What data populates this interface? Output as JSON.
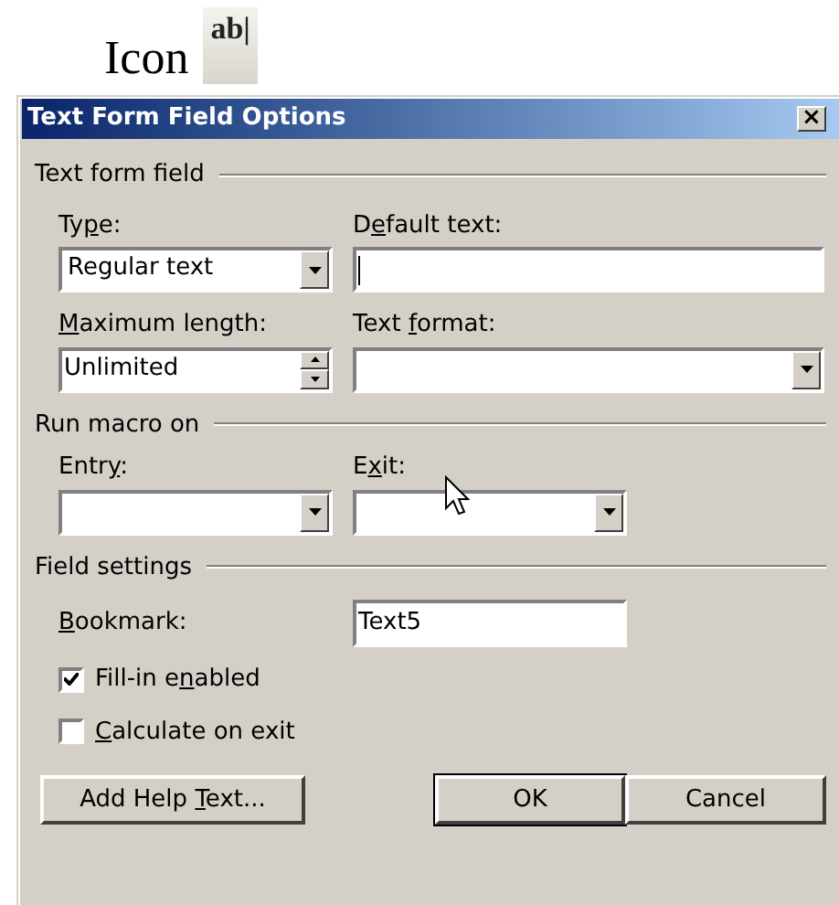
{
  "heading": {
    "text": "Icon",
    "icon_text": "ab|"
  },
  "window": {
    "title": "Text Form Field Options",
    "close": "×"
  },
  "sections": [
    {
      "title": "Text form field",
      "rows": [
        [
          {
            "kind": "combo",
            "label": {
              "before": "Ty",
              "key": "p",
              "after": "e:"
            },
            "value": "Regular text"
          },
          {
            "kind": "text",
            "label": {
              "before": "D",
              "key": "e",
              "after": "fault text:"
            },
            "focused": true
          }
        ],
        [
          {
            "kind": "spin",
            "label": {
              "key": "M",
              "after": "aximum length:"
            },
            "value": "Unlimited"
          },
          {
            "kind": "combo",
            "label": {
              "before": "Text ",
              "key": "f",
              "after": "ormat:"
            }
          }
        ]
      ]
    },
    {
      "title": "Run macro on",
      "rows": [
        [
          {
            "kind": "combo",
            "label": {
              "before": "Entr",
              "key": "y",
              "after": ":"
            }
          },
          {
            "kind": "combo",
            "label": {
              "before": "E",
              "key": "x",
              "after": "it:"
            }
          }
        ]
      ]
    },
    {
      "title": "Field settings",
      "bookmark": {
        "label": {
          "key": "B",
          "after": "ookmark:"
        },
        "value": "Text5"
      },
      "checks": [
        {
          "label": {
            "before": "Fill-in e",
            "key": "n",
            "after": "abled"
          },
          "checked": true
        },
        {
          "label": {
            "key": "C",
            "after": "alculate on exit"
          },
          "checked": false
        }
      ]
    }
  ],
  "buttons": [
    {
      "label": {
        "before": "Add Help ",
        "key": "T",
        "after": "ext..."
      },
      "default": false
    },
    {
      "label": {
        "before": "OK"
      },
      "default": true
    },
    {
      "label": {
        "before": "Cancel"
      },
      "default": false
    }
  ]
}
